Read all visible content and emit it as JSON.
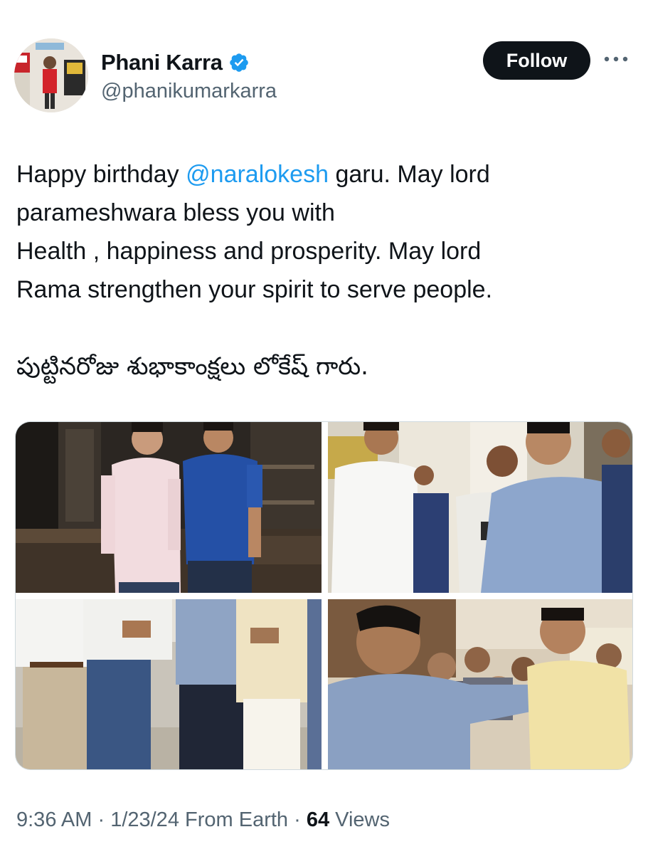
{
  "author": {
    "display_name": "Phani Karra",
    "handle": "@phanikumarkarra",
    "verified_icon": "verified-badge-icon",
    "avatar_icon": "profile-photo"
  },
  "actions": {
    "follow_label": "Follow",
    "more_icon": "more-options-icon"
  },
  "tweet": {
    "line1_before": "Happy birthday ",
    "mention": "@naralokesh",
    "line1_after": " garu. May lord",
    "line2": "parameshwara bless you with",
    "line3": "Health , happiness and prosperity. May lord",
    "line4": "Rama strengthen your spirit to serve people.",
    "telugu": "పుట్టినరోజు శుభాకాంక్షలు లోకేష్ గారు."
  },
  "media": {
    "photos": [
      "two-men-restaurant-photo",
      "greeting-group-photo",
      "group-standing-photo",
      "cake-feeding-photo"
    ]
  },
  "meta": {
    "time": "9:36 AM",
    "separator1": " · ",
    "date": "1/23/24",
    "source": " From Earth",
    "separator2": " · ",
    "views_count": "64",
    "views_label": " Views"
  },
  "colors": {
    "accent": "#1d9bf0",
    "text": "#0f1419",
    "secondary": "#536471",
    "follow_bg": "#0f1419"
  }
}
